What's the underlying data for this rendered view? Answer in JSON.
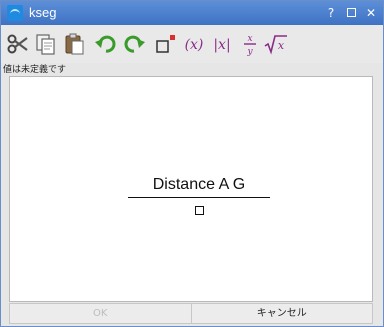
{
  "window": {
    "title": "kseg",
    "controls": {
      "help": "?",
      "close": "✕"
    }
  },
  "toolbar": {
    "buttons": [
      {
        "name": "cut-icon"
      },
      {
        "name": "copy-icon"
      },
      {
        "name": "paste-icon"
      },
      {
        "name": "undo-icon"
      },
      {
        "name": "redo-icon"
      },
      {
        "name": "superscript-icon"
      },
      {
        "name": "parentheses-icon",
        "label": "(x)"
      },
      {
        "name": "absolute-value-icon",
        "label": "|x|"
      },
      {
        "name": "fraction-icon",
        "label": "x/y"
      },
      {
        "name": "square-root-icon",
        "label": "√x"
      }
    ]
  },
  "status": {
    "text": "値は未定義です"
  },
  "editor": {
    "numerator": "Distance A G",
    "denominator_placeholder": "□"
  },
  "buttons": {
    "ok": "OK",
    "cancel": "キャンセル"
  }
}
